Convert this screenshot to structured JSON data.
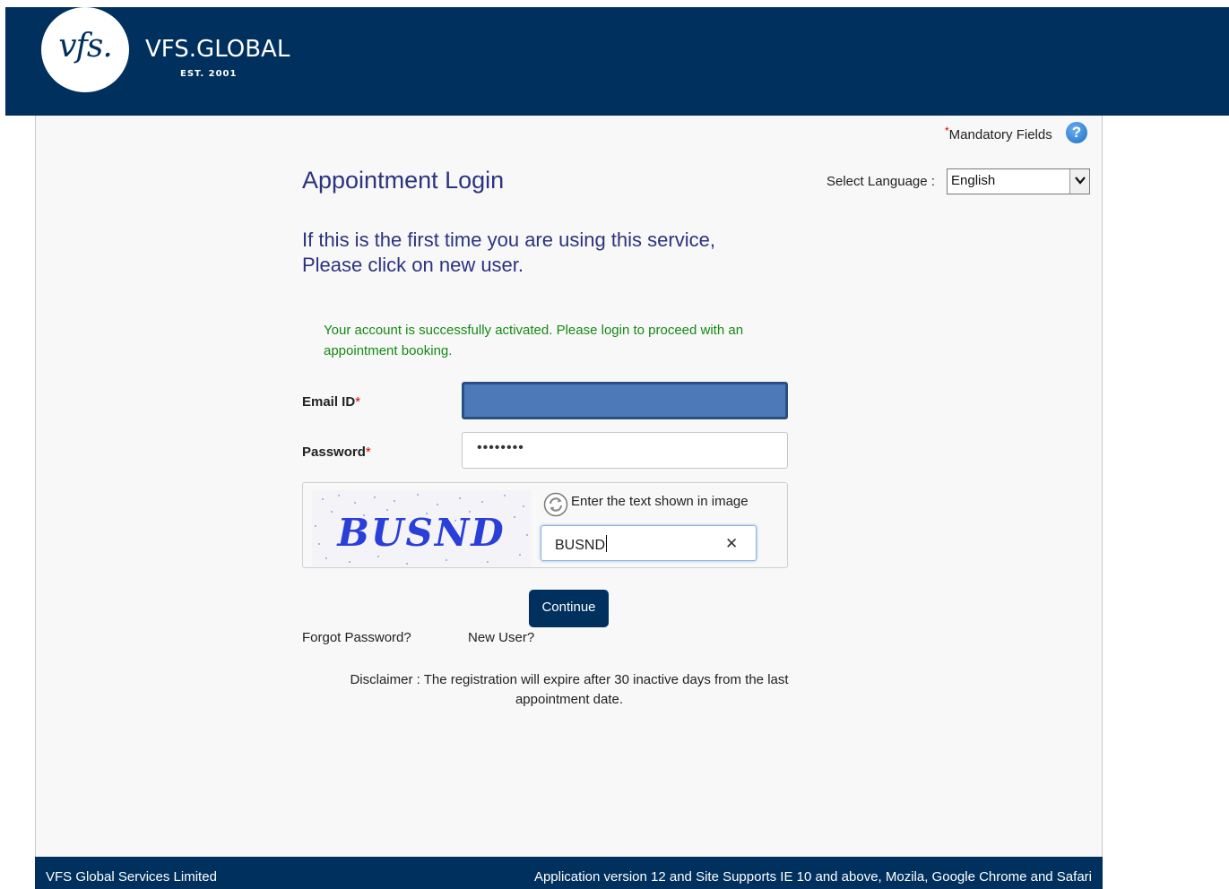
{
  "header": {
    "logo_text": "vfs.",
    "brand_name": "VFS.GLOBAL",
    "established": "EST. 2001",
    "bg_color": "#00305e"
  },
  "mandatory_note": {
    "star": "*",
    "label": "Mandatory Fields",
    "help_icon": "question-circle-icon",
    "help_glyph": "?"
  },
  "page_title": "Appointment Login",
  "language": {
    "label": "Select Language :",
    "selected": "English"
  },
  "intro": {
    "line1": "If this is the first time you are using this service,",
    "line2": "Please click on new user."
  },
  "success_message": "Your account is successfully activated. Please login to proceed with an appointment booking.",
  "form": {
    "email_label": "Email ID",
    "password_label": "Password",
    "required_mark": "*",
    "password_value": "••••••••",
    "captcha_image_text": "BUSND",
    "captcha_hint": "Enter the text shown in image",
    "captcha_value": "BUSND",
    "clear_glyph": "✕"
  },
  "actions": {
    "continue": "Continue",
    "forgot_password": "Forgot Password?",
    "new_user": "New User?"
  },
  "disclaimer": "Disclaimer : The registration will expire after 30 inactive days from the last appointment date.",
  "footer": {
    "company": "VFS Global Services Limited",
    "version_info": "Application version 12 and Site Supports IE 10 and above, Mozila, Google Chrome and Safari"
  },
  "colors": {
    "brand_navy": "#00305e",
    "title_blue": "#2c3380",
    "success_green": "#148a14",
    "required_red": "#dd0000"
  }
}
